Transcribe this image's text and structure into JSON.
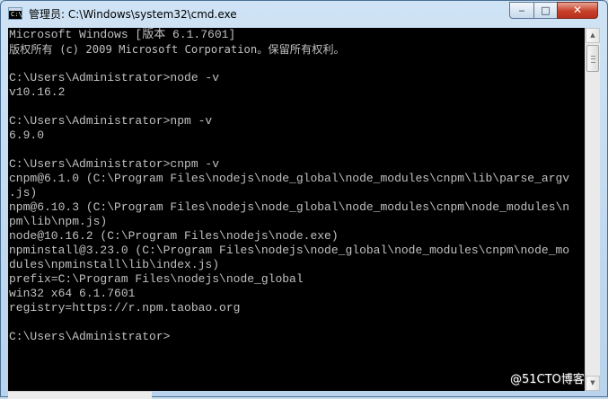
{
  "window": {
    "title": "管理员: C:\\Windows\\system32\\cmd.exe",
    "icon": "cmd-icon",
    "controls": {
      "minimize": "‒",
      "maximize": "□",
      "close": "✕"
    }
  },
  "console": {
    "lines": [
      "Microsoft Windows [版本 6.1.7601]",
      "版权所有 (c) 2009 Microsoft Corporation。保留所有权利。",
      "",
      "C:\\Users\\Administrator>node -v",
      "v10.16.2",
      "",
      "C:\\Users\\Administrator>npm -v",
      "6.9.0",
      "",
      "C:\\Users\\Administrator>cnpm -v",
      "cnpm@6.1.0 (C:\\Program Files\\nodejs\\node_global\\node_modules\\cnpm\\lib\\parse_argv",
      ".js)",
      "npm@6.10.3 (C:\\Program Files\\nodejs\\node_global\\node_modules\\cnpm\\node_modules\\n",
      "pm\\lib\\npm.js)",
      "node@10.16.2 (C:\\Program Files\\nodejs\\node.exe)",
      "npminstall@3.23.0 (C:\\Program Files\\nodejs\\node_global\\node_modules\\cnpm\\node_mo",
      "dules\\npminstall\\lib\\index.js)",
      "prefix=C:\\Program Files\\nodejs\\node_global",
      "win32 x64 6.1.7601",
      "registry=https://r.npm.taobao.org",
      "",
      "C:\\Users\\Administrator>"
    ]
  },
  "watermark": "@51CTO博客"
}
